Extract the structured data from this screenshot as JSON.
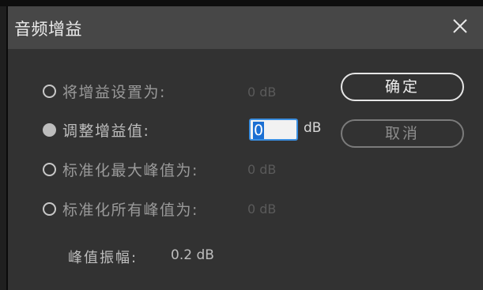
{
  "dialog": {
    "title": "音频增益",
    "close_icon": "close-icon"
  },
  "options": [
    {
      "label": "将增益设置为:",
      "value": "0 dB",
      "selected": false
    },
    {
      "label": "调整增益值:",
      "value": "0",
      "unit": "dB",
      "selected": true
    },
    {
      "label": "标准化最大峰值为:",
      "value": "0 dB",
      "selected": false
    },
    {
      "label": "标准化所有峰值为:",
      "value": "0 dB",
      "selected": false
    }
  ],
  "peak": {
    "label": "峰值振幅:",
    "value": "0.2 dB"
  },
  "buttons": {
    "ok_label": "确定",
    "cancel_label": "取消"
  },
  "colors": {
    "background": "#323232",
    "titlebar": "#474747",
    "input_highlight": "#1b6fd3"
  }
}
